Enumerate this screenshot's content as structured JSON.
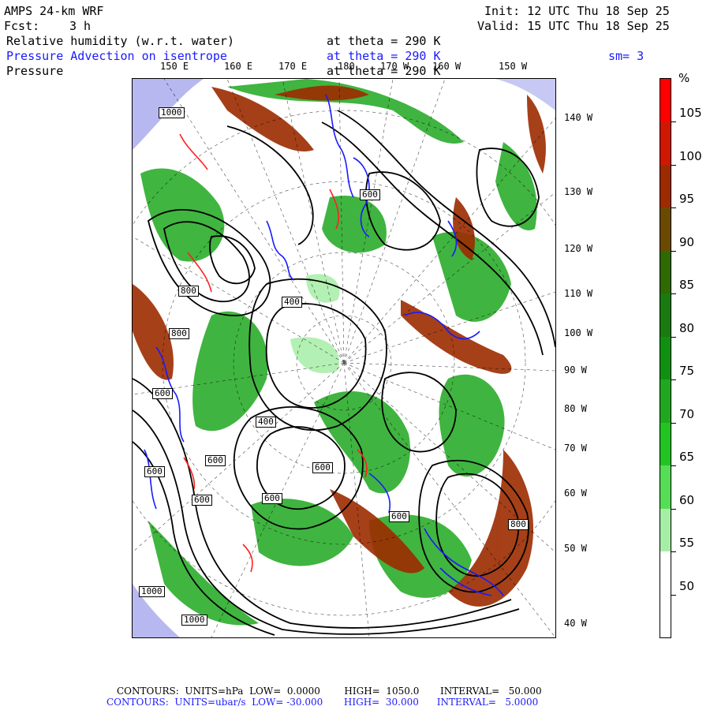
{
  "header": {
    "model": "AMPS 24-km WRF",
    "fcst_label": "Fcst:",
    "fcst_value": "3 h",
    "init": "Init: 12 UTC Thu 18 Sep 25",
    "valid": "Valid: 15 UTC Thu 18 Sep 25",
    "field1_name": "Relative humidity (w.r.t. water)",
    "field1_level": "at theta = 290 K",
    "field2_name": "Pressure Advection on isentrope",
    "field2_level": "at theta = 290 K",
    "field2_smooth": "sm= 3",
    "field3_name": "Pressure",
    "field3_level": "at theta = 290 K"
  },
  "map": {
    "top_lon_labels": [
      "150 E",
      "160 E",
      "170 E",
      "180",
      "170 W",
      "160 W",
      "150 W"
    ],
    "right_lon_labels": [
      "140 W",
      "130 W",
      "120 W",
      "110 W",
      "100 W",
      "90 W",
      "80 W",
      "70 W",
      "60 W",
      "50 W",
      "40 W"
    ],
    "contour_labels": [
      "1000",
      "600",
      "800",
      "400",
      "800",
      "400",
      "600",
      "600",
      "600",
      "600",
      "600",
      "600",
      "600",
      "800",
      "1000",
      "1000"
    ],
    "colors": {
      "ocean_edge": "#b8b8f0",
      "black_contour": "#000000",
      "blue_contour": "#1a1aff",
      "red_contour": "#ff2020"
    }
  },
  "colorbar": {
    "unit": "%",
    "labels": [
      "105",
      "100",
      "95",
      "90",
      "85",
      "80",
      "75",
      "70",
      "65",
      "60",
      "55",
      "50"
    ],
    "colors": [
      "#ff0000",
      "#d01800",
      "#9c2b00",
      "#6b4a00",
      "#2e6a00",
      "#1a7a10",
      "#0f9010",
      "#1fa81f",
      "#22c422",
      "#55dd55",
      "#a6eea6",
      "#ffffff",
      "#ffffff"
    ]
  },
  "footer": {
    "line1": "CONTOURS:  UNITS=hPa  LOW=  0.0000        HIGH=  1050.0       INTERVAL=   50.000",
    "line2": "CONTOURS:  UNITS=ubar/s  LOW= -30.000       HIGH=  30.000      INTERVAL=   5.0000"
  }
}
